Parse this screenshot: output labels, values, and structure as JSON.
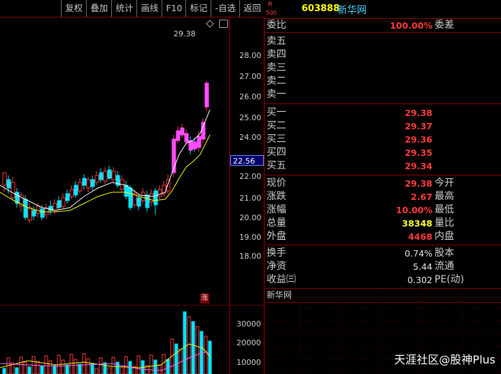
{
  "toolbar": [
    "复权",
    "叠加",
    "统计",
    "画线",
    "F10",
    "标记",
    "-自选",
    "返回"
  ],
  "chart": {
    "price_label_top": "29.38",
    "axis_labels": [
      "28.00",
      "27.00",
      "26.00",
      "25.00",
      "24.00",
      "22.56",
      "22.00",
      "21.00",
      "20.00",
      "19.00",
      "18.00"
    ],
    "current_price_box": "22.56",
    "limit_badge": "涨",
    "vol_axis_labels": [
      "30000",
      "20000",
      "10000"
    ]
  },
  "stock": {
    "badge_r": "R",
    "badge_500": "500",
    "code": "603888",
    "name": "新华网"
  },
  "weibi": {
    "label": "委比",
    "value": "100.00%",
    "label2": "委差"
  },
  "sell": [
    {
      "label": "卖五",
      "value": ""
    },
    {
      "label": "卖四",
      "value": ""
    },
    {
      "label": "卖三",
      "value": ""
    },
    {
      "label": "卖二",
      "value": ""
    },
    {
      "label": "卖一",
      "value": ""
    }
  ],
  "buy": [
    {
      "label": "买一",
      "value": "29.38"
    },
    {
      "label": "买二",
      "value": "29.37"
    },
    {
      "label": "买三",
      "value": "29.36"
    },
    {
      "label": "买四",
      "value": "29.35"
    },
    {
      "label": "买五",
      "value": "29.34"
    }
  ],
  "quote": [
    {
      "label": "现价",
      "value": "29.38",
      "label2": "今开",
      "color": "red"
    },
    {
      "label": "涨跌",
      "value": "2.67",
      "label2": "最高",
      "color": "red"
    },
    {
      "label": "涨幅",
      "value": "10.00%",
      "label2": "最低",
      "color": "red"
    },
    {
      "label": "总量",
      "value": "38348",
      "label2": "量比",
      "color": "yellow"
    },
    {
      "label": "外盘",
      "value": "4468",
      "label2": "内盘",
      "color": "red"
    }
  ],
  "extra": [
    {
      "label": "换手",
      "value": "0.74%",
      "label2": "股本"
    },
    {
      "label": "净资",
      "value": "5.44",
      "label2": "流通"
    },
    {
      "label": "收益㈢",
      "value": "0.302",
      "label2": "PE(动)"
    }
  ],
  "footer_name": "新华网",
  "watermark": "天涯社区@股神Plus",
  "colors": {
    "up": "#ff3b3b",
    "down": "#00ffff",
    "ma5": "#ffffff",
    "ma10": "#ffff00",
    "accent_border": "#b00000"
  }
}
